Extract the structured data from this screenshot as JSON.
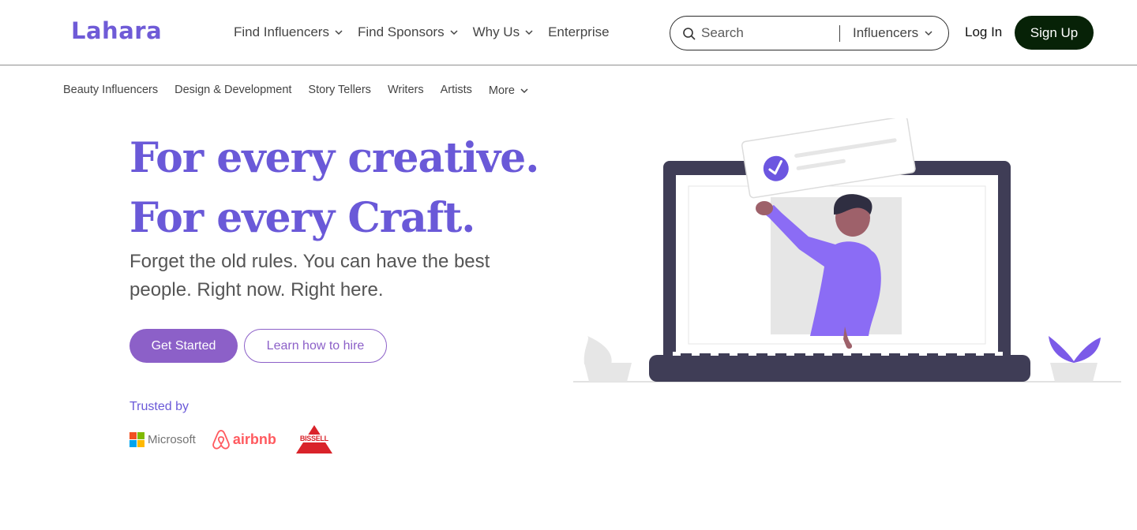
{
  "header": {
    "logo": "Lahara",
    "nav": [
      {
        "label": "Find Influencers",
        "has_dropdown": true
      },
      {
        "label": "Find Sponsors",
        "has_dropdown": true
      },
      {
        "label": "Why Us",
        "has_dropdown": true
      },
      {
        "label": "Enterprise",
        "has_dropdown": false
      }
    ],
    "search": {
      "placeholder": "Search",
      "type_label": "Influencers"
    },
    "login_label": "Log In",
    "signup_label": "Sign Up"
  },
  "categories": {
    "items": [
      "Beauty Influencers",
      "Design & Development",
      "Story Tellers",
      "Writers",
      "Artists"
    ],
    "more_label": "More"
  },
  "hero": {
    "title_line1": "For every creative.",
    "title_line2": "For every Craft.",
    "subtitle": "Forget the old rules. You can have the best people. Right now. Right here.",
    "primary_cta": "Get Started",
    "secondary_cta": "Learn how to hire"
  },
  "trusted": {
    "label": "Trusted by",
    "brands": [
      {
        "name": "Microsoft",
        "icon": "microsoft-logo"
      },
      {
        "name": "airbnb",
        "icon": "airbnb-logo"
      },
      {
        "name": "BISSELL",
        "icon": "bissell-logo"
      }
    ]
  },
  "colors": {
    "brand_purple": "#6a59d8",
    "cta_purple": "#8c60c8",
    "signup_bg": "#072207",
    "laptop_dark": "#3f3d56",
    "person_shirt": "#8b6cf5"
  }
}
